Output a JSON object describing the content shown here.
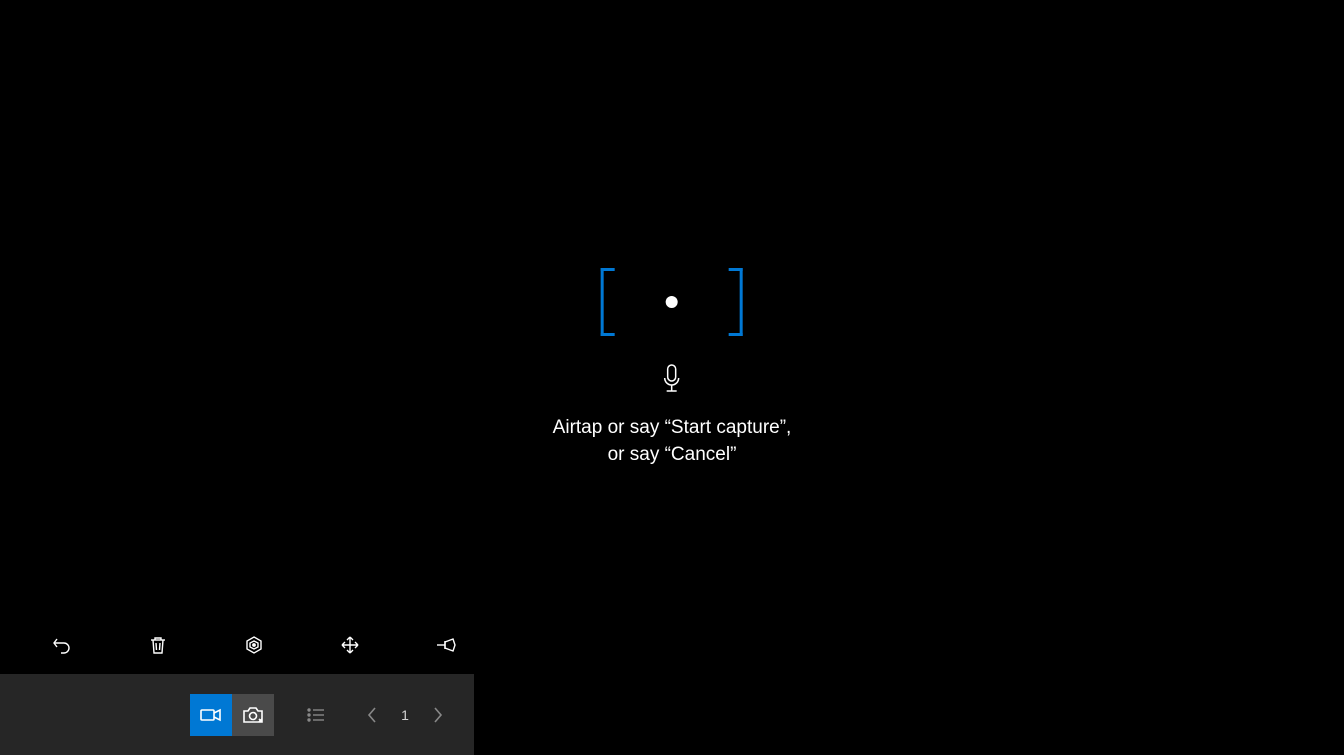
{
  "center": {
    "instruction_line1": "Airtap or say “Start capture”,",
    "instruction_line2": "or say “Cancel”"
  },
  "toolbar": {
    "items": [
      {
        "name": "undo"
      },
      {
        "name": "delete"
      },
      {
        "name": "target"
      },
      {
        "name": "move"
      },
      {
        "name": "pin"
      }
    ]
  },
  "bottombar": {
    "page": "1"
  },
  "colors": {
    "accent": "#0078d4",
    "darkgrey": "#262626",
    "midgrey": "#4a4a4a"
  }
}
